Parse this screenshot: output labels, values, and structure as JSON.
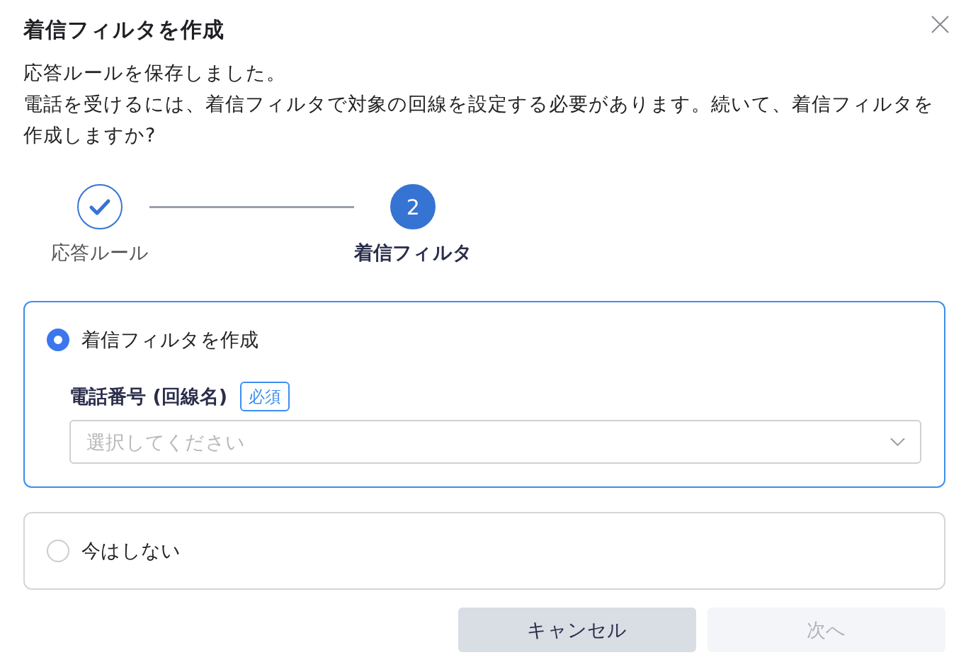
{
  "dialog": {
    "title": "着信フィルタを作成",
    "message": [
      "応答ルールを保存しました。",
      "電話を受けるには、着信フィルタで対象の回線を設定する必要があります。続いて、着信フィルタを作成しますか?"
    ]
  },
  "stepper": {
    "steps": [
      {
        "label": "応答ルール",
        "completed": true,
        "selected": false
      },
      {
        "label": "着信フィルタ",
        "number": "2",
        "completed": false,
        "selected": true
      }
    ]
  },
  "options": [
    {
      "label": "着信フィルタを作成",
      "selected": true,
      "field": {
        "label": "電話番号 (回線名)",
        "required_badge": "必須",
        "placeholder": "選択してください"
      }
    },
    {
      "label": "今はしない",
      "selected": false
    }
  ],
  "buttons": [
    {
      "kind": "cancel",
      "label": "キャンセル",
      "disabled": false
    },
    {
      "kind": "next",
      "label": "次へ",
      "disabled": true
    }
  ]
}
